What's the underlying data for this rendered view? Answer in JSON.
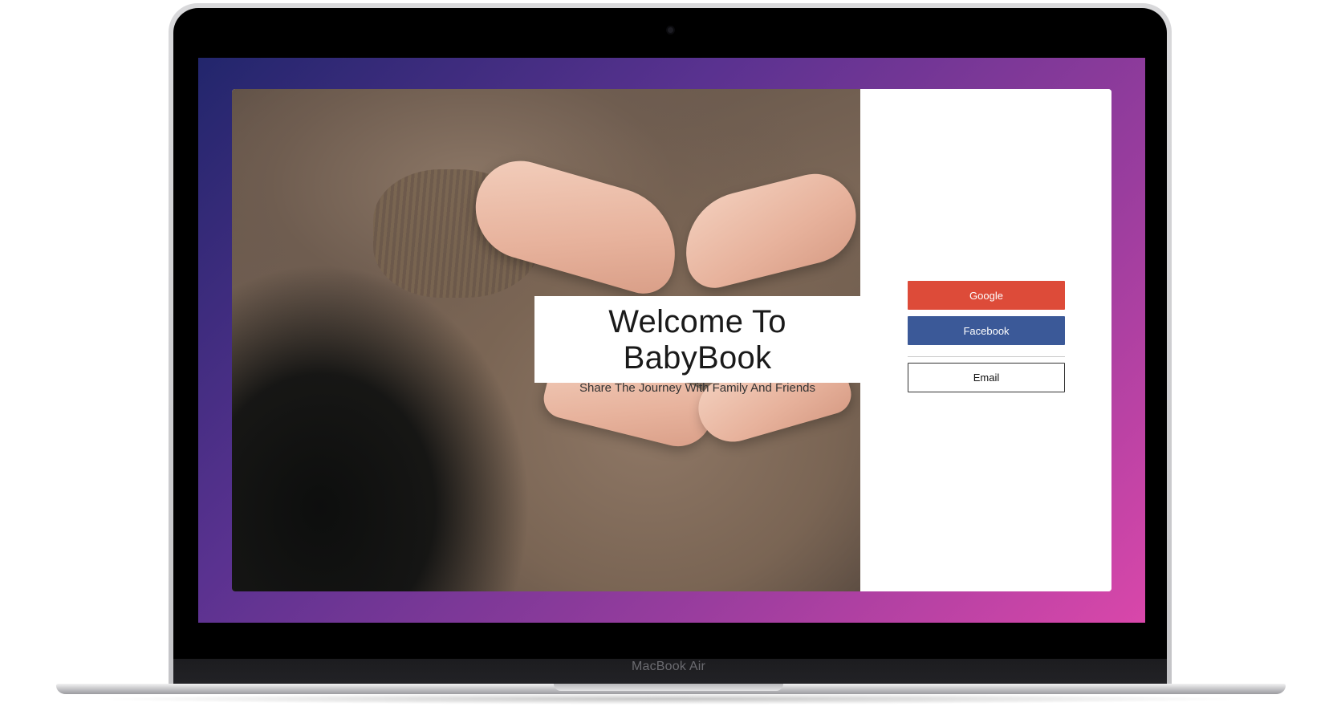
{
  "device": {
    "label": "MacBook Air"
  },
  "app": {
    "welcome_title": "Welcome To BabyBook",
    "welcome_subtitle": "Share The Journey With Family And Friends"
  },
  "signin": {
    "google_label": "Google",
    "facebook_label": "Facebook",
    "email_label": "Email"
  },
  "colors": {
    "google": "#dd4b39",
    "facebook": "#3b5998",
    "background_gradient_start": "#22266c",
    "background_gradient_end": "#d947aa"
  }
}
